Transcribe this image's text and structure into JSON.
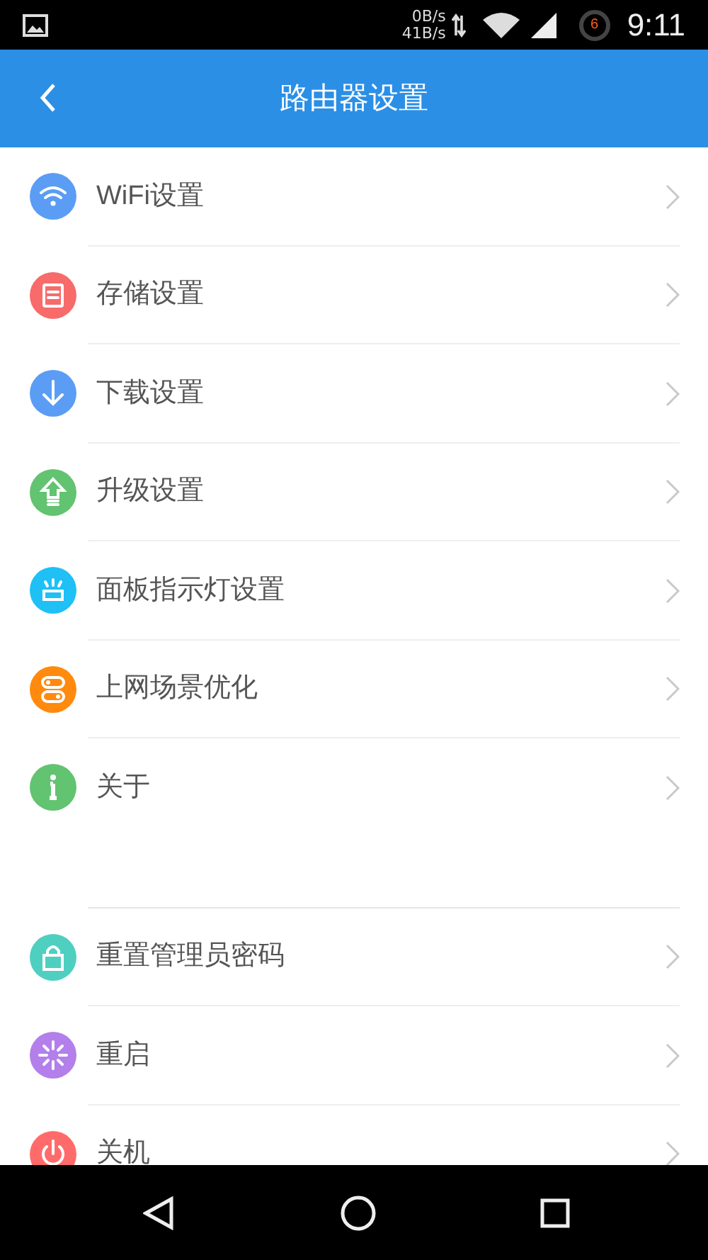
{
  "status_bar": {
    "download_speed": "0B/s",
    "upload_speed": "41B/s",
    "notification_count": "6",
    "time": "9:11"
  },
  "header": {
    "title": "路由器设置"
  },
  "groups": [
    {
      "items": [
        {
          "label": "WiFi设置",
          "color": "#5b9df5"
        },
        {
          "label": "存储设置",
          "color": "#f76b6b"
        },
        {
          "label": "下载设置",
          "color": "#5b9df5"
        },
        {
          "label": "升级设置",
          "color": "#62c370"
        },
        {
          "label": "面板指示灯设置",
          "color": "#1ec0f5"
        },
        {
          "label": "上网场景优化",
          "color": "#ff8a0d"
        },
        {
          "label": "关于",
          "color": "#62c370"
        }
      ]
    },
    {
      "items": [
        {
          "label": "重置管理员密码",
          "color": "#4fcfc0"
        },
        {
          "label": "重启",
          "color": "#b37feb"
        },
        {
          "label": "关机",
          "color": "#ff6b6b"
        }
      ]
    }
  ]
}
